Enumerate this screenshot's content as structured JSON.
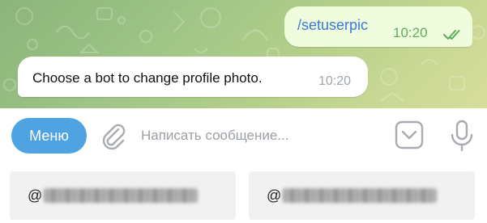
{
  "chat": {
    "outgoing": {
      "text": "/setuserpic",
      "time": "10:20"
    },
    "incoming": {
      "text": "Choose a bot to change profile photo.",
      "time": "10:20"
    }
  },
  "composer": {
    "menu_label": "Меню",
    "placeholder": "Написать сообщение..."
  },
  "reply_keyboard": {
    "buttons": [
      {
        "prefix": "@",
        "redacted": true
      },
      {
        "prefix": "@",
        "redacted": true
      }
    ]
  },
  "colors": {
    "accent": "#4fa3e0",
    "outgoing_bubble": "#effdde",
    "outgoing_text": "#3a7bd5",
    "outgoing_time": "#5eac58",
    "incoming_time": "#a0a6ad",
    "icon": "#a8acb0"
  },
  "icons": {
    "read_receipt": "double-check-icon",
    "attach": "paperclip-icon",
    "keyboard": "keyboard-toggle-icon",
    "mic": "microphone-icon"
  }
}
